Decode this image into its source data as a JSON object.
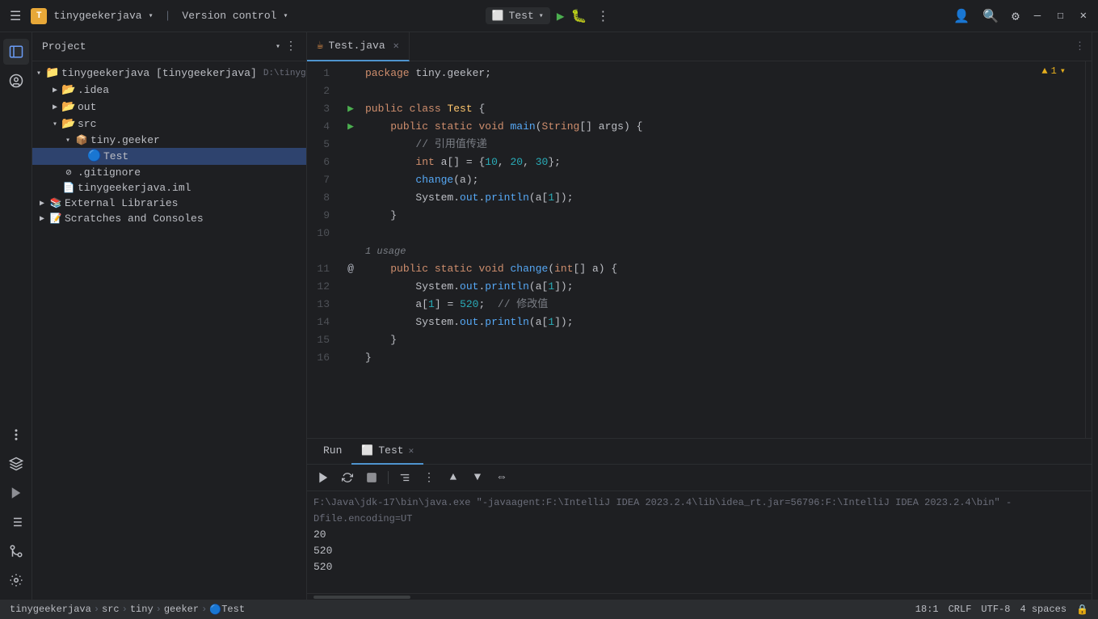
{
  "titleBar": {
    "logo": "T",
    "projectName": "tinygeekerjava",
    "pathHint": "D:\\tinyge",
    "versionControl": "Version control",
    "runConfig": "Test",
    "menuIcon": "☰",
    "moreIcon": "⋮",
    "minimize": "—",
    "maximize": "☐",
    "close": "✕"
  },
  "sidebar": {
    "projectLabel": "Project",
    "icons": [
      "📁",
      "🔍",
      "⚙",
      "🔧"
    ]
  },
  "fileTree": {
    "root": "tinygeekerjava [tinygeekerjava]",
    "rootPath": "D:\\tinyge",
    "items": [
      {
        "label": ".idea",
        "indent": 1,
        "type": "folder",
        "expanded": false
      },
      {
        "label": "out",
        "indent": 1,
        "type": "folder",
        "expanded": false
      },
      {
        "label": "src",
        "indent": 1,
        "type": "folder",
        "expanded": true
      },
      {
        "label": "tiny.geeker",
        "indent": 2,
        "type": "package",
        "expanded": true
      },
      {
        "label": "Test",
        "indent": 3,
        "type": "class",
        "selected": true
      },
      {
        "label": ".gitignore",
        "indent": 1,
        "type": "file"
      },
      {
        "label": "tinygeekerjava.iml",
        "indent": 1,
        "type": "file"
      },
      {
        "label": "External Libraries",
        "indent": 0,
        "type": "library",
        "expanded": false
      },
      {
        "label": "Scratches and Consoles",
        "indent": 0,
        "type": "scratches",
        "expanded": false
      }
    ]
  },
  "editor": {
    "tabName": "Test.java",
    "warningCount": "▲ 1",
    "lines": [
      {
        "num": 1,
        "gutter": "",
        "content": "package tiny.geeker;"
      },
      {
        "num": 2,
        "gutter": "",
        "content": ""
      },
      {
        "num": 3,
        "gutter": "▶",
        "content": "public class Test {"
      },
      {
        "num": 4,
        "gutter": "▶",
        "content": "    public static void main(String[] args) {"
      },
      {
        "num": 5,
        "gutter": "",
        "content": "        // 引用值传递"
      },
      {
        "num": 6,
        "gutter": "",
        "content": "        int a[] = {10, 20, 30};"
      },
      {
        "num": 7,
        "gutter": "",
        "content": "        change(a);"
      },
      {
        "num": 8,
        "gutter": "",
        "content": "        System.out.println(a[1]);"
      },
      {
        "num": 9,
        "gutter": "",
        "content": "    }"
      },
      {
        "num": 10,
        "gutter": "",
        "content": ""
      },
      {
        "num": 11,
        "gutter": "@",
        "content": "    public static void change(int[] a) {"
      },
      {
        "num": 12,
        "gutter": "",
        "content": "        System.out.println(a[1]);"
      },
      {
        "num": 13,
        "gutter": "",
        "content": "        a[1] = 520;  // 修改值"
      },
      {
        "num": 14,
        "gutter": "",
        "content": "        System.out.println(a[1]);"
      },
      {
        "num": 15,
        "gutter": "",
        "content": "    }"
      },
      {
        "num": 16,
        "gutter": "",
        "content": "}"
      }
    ],
    "usageHint": "1 usage"
  },
  "bottomPanel": {
    "tabs": [
      {
        "label": "Run",
        "active": false
      },
      {
        "label": "Test",
        "active": true,
        "closable": true
      }
    ],
    "toolbarButtons": [
      "▶",
      "↺",
      "⏹",
      "📋",
      "⋮"
    ],
    "consoleLine1": "F:\\Java\\jdk-17\\bin\\java.exe \"-javaagent:F:\\IntelliJ IDEA 2023.2.4\\lib\\idea_rt.jar=56796:F:\\IntelliJ IDEA 2023.2.4\\bin\" -Dfile.encoding=UT",
    "output": [
      "20",
      "520",
      "520"
    ]
  },
  "statusBar": {
    "breadcrumbs": [
      "tinygeekerjava",
      "src",
      "tiny",
      "geeker",
      "Test"
    ],
    "position": "18:1",
    "lineEnding": "CRLF",
    "encoding": "UTF-8",
    "indent": "4 spaces"
  },
  "rightPanel": {
    "notificationIcon": "🔔",
    "bookmarkIcon": "🔖"
  }
}
